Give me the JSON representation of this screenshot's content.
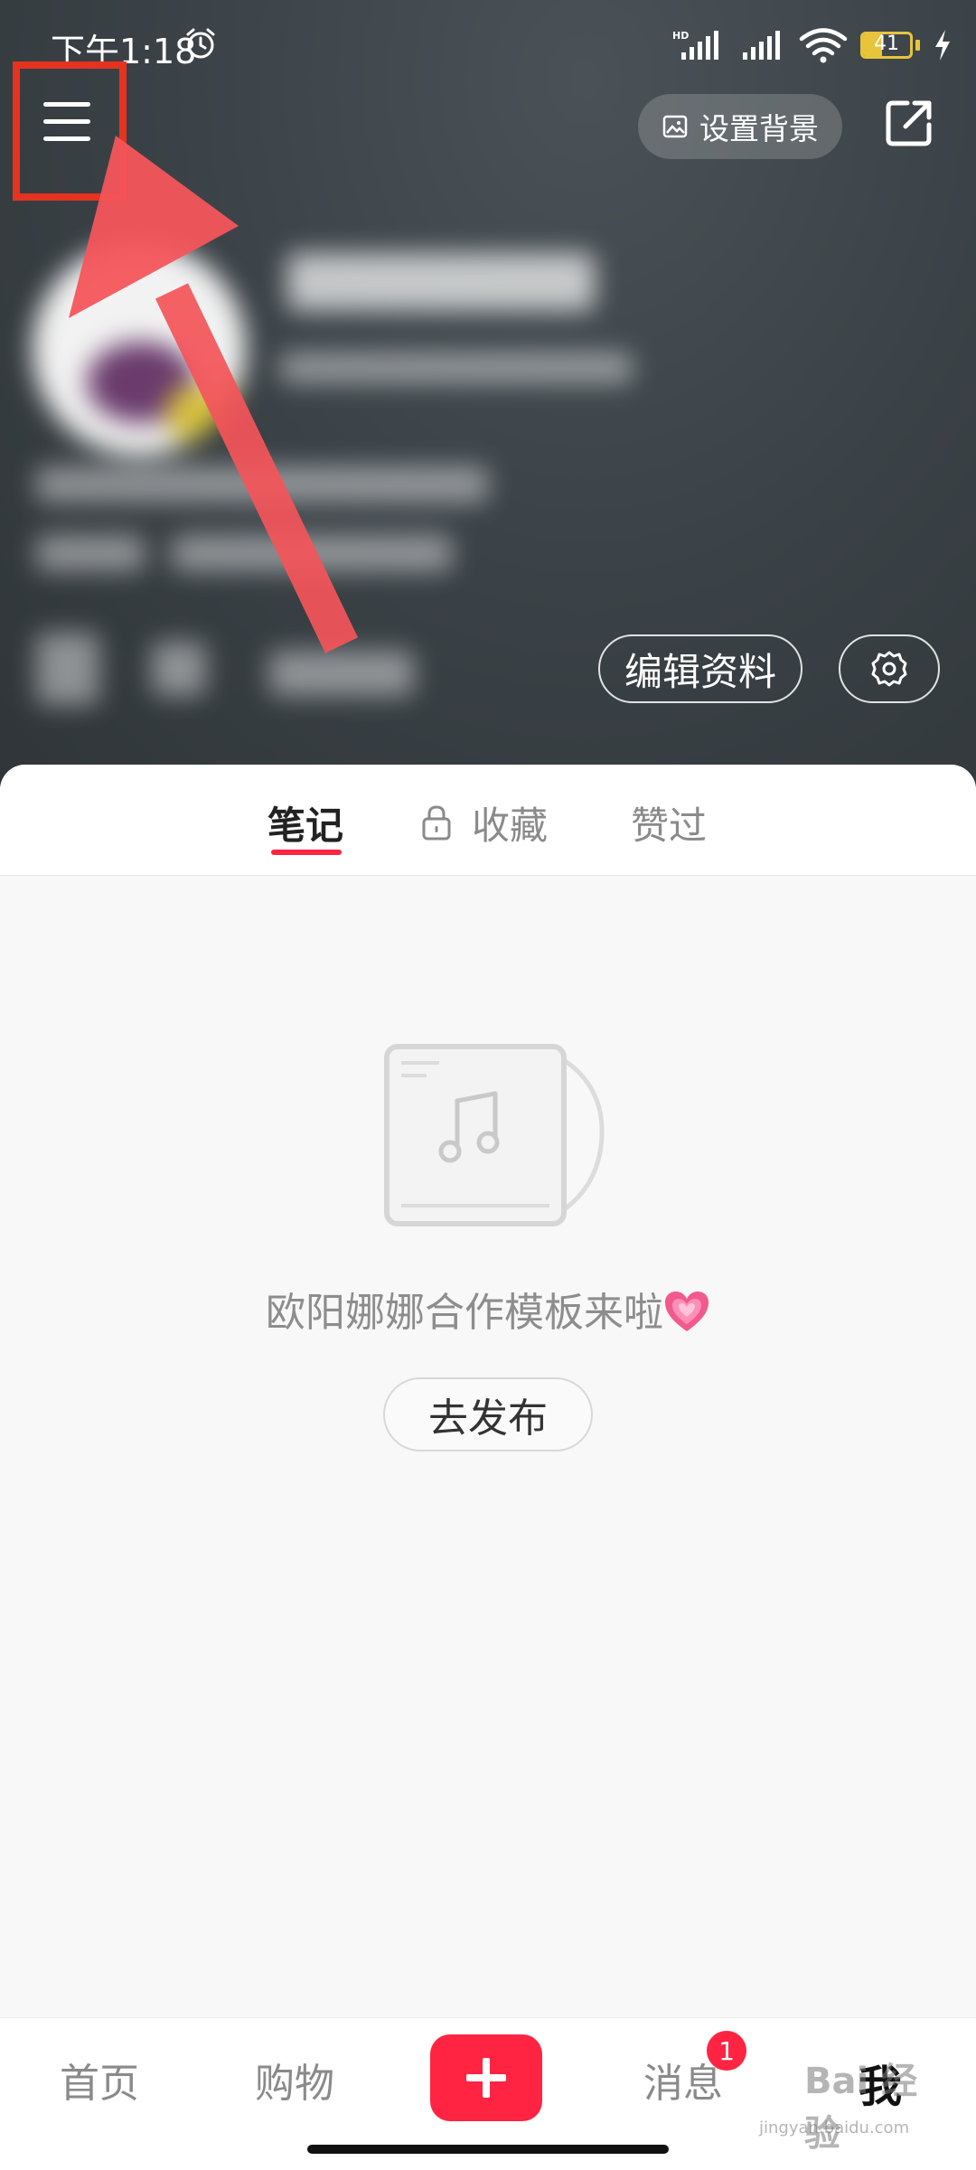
{
  "status_bar": {
    "time": "下午1:18",
    "battery": "41",
    "network_label": "HD"
  },
  "header": {
    "set_background_label": "设置背景",
    "edit_profile_label": "编辑资料"
  },
  "tabs": [
    {
      "label": "笔记",
      "active": true
    },
    {
      "label": "收藏",
      "active": false,
      "locked": true
    },
    {
      "label": "赞过",
      "active": false
    }
  ],
  "empty_state": {
    "text": "欧阳娜娜合作模板来啦",
    "button_label": "去发布"
  },
  "bottom_nav": {
    "items": [
      "首页",
      "购物",
      "消息",
      "我"
    ],
    "messages_badge": "1"
  },
  "watermark": {
    "text": "Bai 经验",
    "url": "jingyan.baidu.com"
  },
  "colors": {
    "accent": "#ff2442",
    "annotation": "#e5331f",
    "arrow": "#f4555a"
  }
}
